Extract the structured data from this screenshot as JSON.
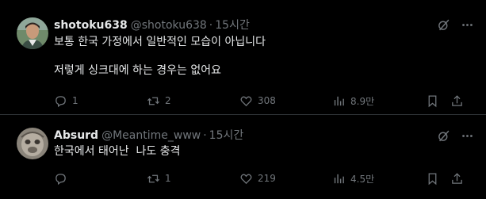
{
  "tweets": [
    {
      "name": "shotoku638",
      "handle": "@shotoku638",
      "dot": "·",
      "time": "15시간",
      "text": "보통 한국 가정에서 일반적인 모습이 아닙니다\n\n저렇게 싱크대에 하는 경우는 없어요",
      "replies": "1",
      "retweets": "2",
      "likes": "308",
      "views": "8.9만"
    },
    {
      "name": "Absurd",
      "handle": "@Meantime_www",
      "dot": "·",
      "time": "15시간",
      "text": "한국에서 태어난  나도 충격",
      "replies": "",
      "retweets": "1",
      "likes": "219",
      "views": "4.5만"
    }
  ],
  "icons": {
    "grok": "grok-icon",
    "more": "more-icon",
    "reply": "reply-icon",
    "retweet": "retweet-icon",
    "like": "like-icon",
    "views": "views-icon",
    "bookmark": "bookmark-icon",
    "share": "share-icon"
  },
  "colors": {
    "background": "#000000",
    "text": "#e7e9ea",
    "secondary": "#71767b",
    "divider": "#2f3336"
  }
}
